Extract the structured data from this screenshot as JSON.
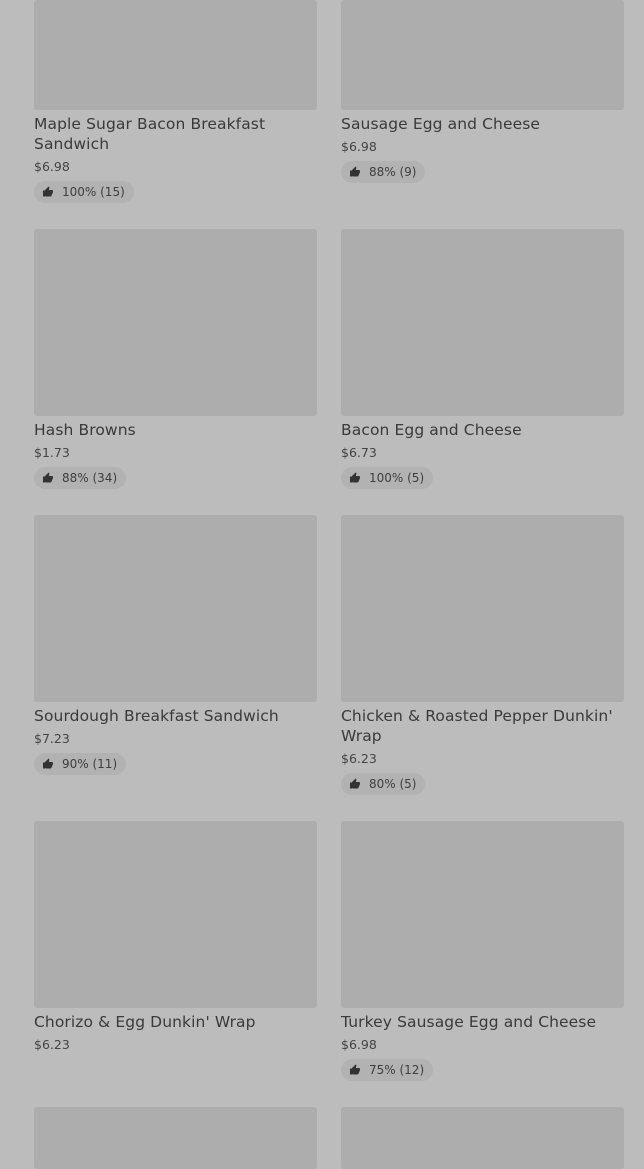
{
  "items": [
    {
      "name": "Maple Sugar Bacon Breakfast Sandwich",
      "price": "$6.98",
      "rating": "100% (15)"
    },
    {
      "name": "Sausage Egg and Cheese",
      "price": "$6.98",
      "rating": "88% (9)"
    },
    {
      "name": "Hash Browns",
      "price": "$1.73",
      "rating": "88% (34)"
    },
    {
      "name": "Bacon Egg and Cheese",
      "price": "$6.73",
      "rating": "100% (5)"
    },
    {
      "name": "Sourdough Breakfast Sandwich",
      "price": "$7.23",
      "rating": "90% (11)"
    },
    {
      "name": "Chicken & Roasted Pepper Dunkin' Wrap",
      "price": "$6.23",
      "rating": "80% (5)"
    },
    {
      "name": "Chorizo & Egg Dunkin' Wrap",
      "price": "$6.23"
    },
    {
      "name": "Turkey Sausage Egg and Cheese",
      "price": "$6.98",
      "rating": "75% (12)"
    }
  ],
  "icons": {
    "rating": "thumbs-up-icon"
  },
  "colors": {
    "background": "#bcbcbc",
    "image_placeholder": "#adadad",
    "rating_pill": "#b2b2b2"
  }
}
